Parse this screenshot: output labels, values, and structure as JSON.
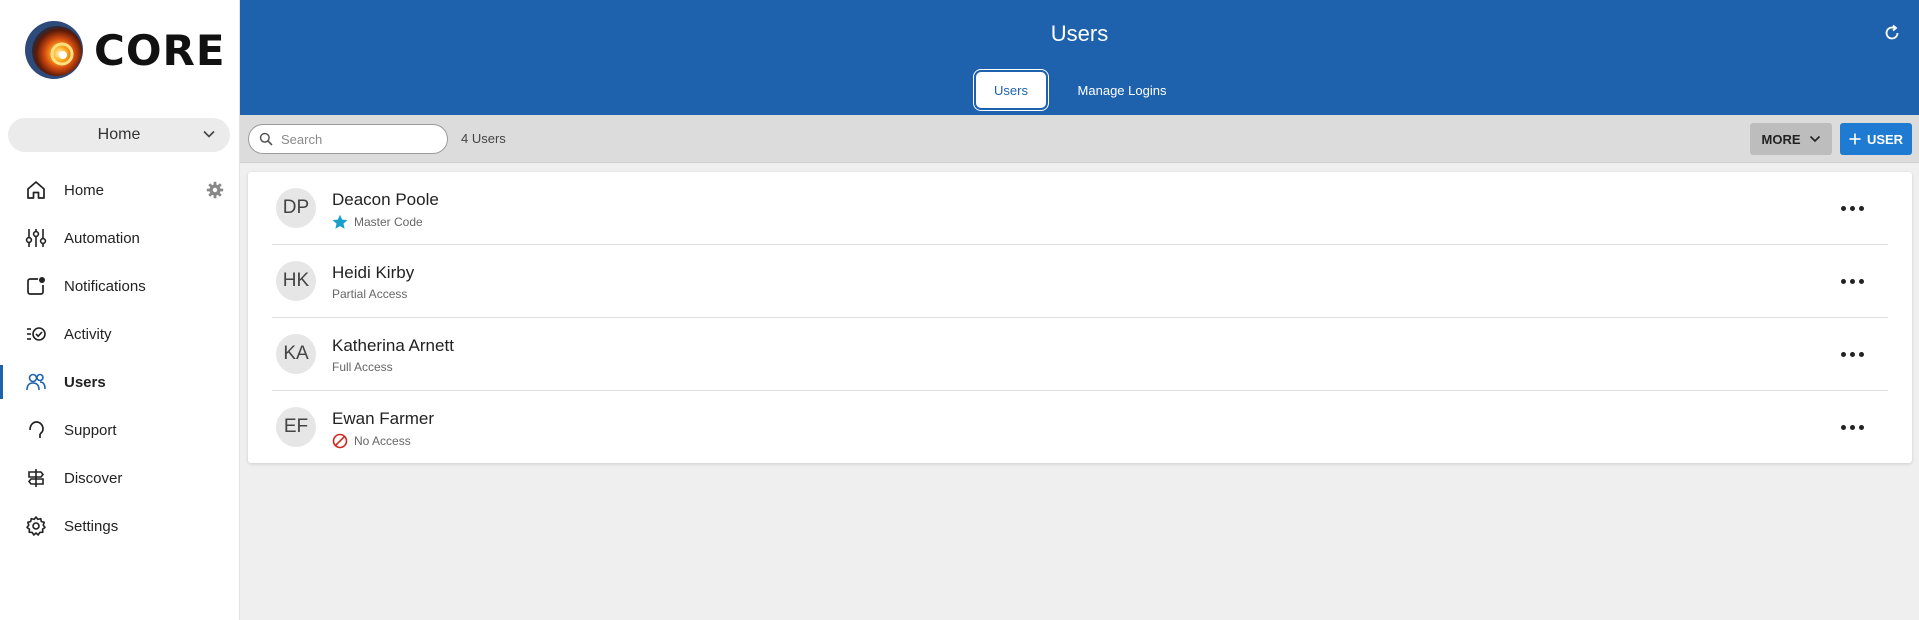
{
  "app": {
    "logo_text": "CORE"
  },
  "sidebar": {
    "location_select": "Home",
    "items": [
      {
        "label": "Home",
        "icon": "home-icon"
      },
      {
        "label": "Automation",
        "icon": "sliders-icon"
      },
      {
        "label": "Notifications",
        "icon": "notification-icon"
      },
      {
        "label": "Activity",
        "icon": "activity-icon"
      },
      {
        "label": "Users",
        "icon": "users-icon",
        "active": true
      },
      {
        "label": "Support",
        "icon": "headset-icon"
      },
      {
        "label": "Discover",
        "icon": "signpost-icon"
      },
      {
        "label": "Settings",
        "icon": "gear-icon"
      }
    ]
  },
  "header": {
    "title": "Users",
    "tabs": [
      {
        "label": "Users",
        "active": true
      },
      {
        "label": "Manage Logins",
        "active": false
      }
    ]
  },
  "toolbar": {
    "search_placeholder": "Search",
    "count": "4 Users",
    "more_label": "MORE",
    "add_label": "USER"
  },
  "users": [
    {
      "initials": "DP",
      "name": "Deacon Poole",
      "status": "Master Code",
      "status_icon": "star-icon"
    },
    {
      "initials": "HK",
      "name": "Heidi Kirby",
      "status": "Partial Access"
    },
    {
      "initials": "KA",
      "name": "Katherina Arnett",
      "status": "Full Access"
    },
    {
      "initials": "EF",
      "name": "Ewan Farmer",
      "status": "No Access",
      "status_icon": "no-access-icon"
    }
  ],
  "colors": {
    "primary": "#1e62ad",
    "add_button": "#1e7bd1",
    "star": "#1aa0c8",
    "no_access": "#d0281e"
  }
}
